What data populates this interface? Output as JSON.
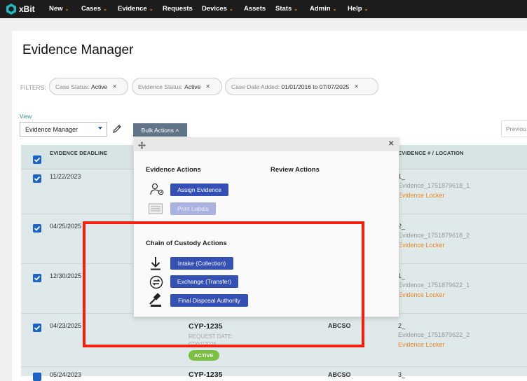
{
  "nav": {
    "brand": "xBit",
    "items": [
      {
        "label": "New",
        "caret": true
      },
      {
        "label": "Cases",
        "caret": true
      },
      {
        "label": "Evidence",
        "caret": true
      },
      {
        "label": "Requests",
        "caret": false
      },
      {
        "label": "Devices",
        "caret": true
      },
      {
        "label": "Assets",
        "caret": false
      },
      {
        "label": "Stats",
        "caret": true
      },
      {
        "label": "Admin",
        "caret": true
      },
      {
        "label": "Help",
        "caret": true
      }
    ]
  },
  "page": {
    "title": "Evidence Manager"
  },
  "filters": {
    "label": "FILTERS:",
    "chips": [
      {
        "name": "Case Status:",
        "value": "Active"
      },
      {
        "name": "Evidence Status:",
        "value": "Active"
      },
      {
        "name": "Case Date Added:",
        "value": "01/01/2016 to 07/07/2025"
      }
    ]
  },
  "view": {
    "label": "View",
    "selected": "Evidence Manager"
  },
  "toolbar": {
    "bulk_actions": "Bulk Actions ˄",
    "previous": "Previou"
  },
  "table": {
    "headers": {
      "deadline": "EVIDENCE DEADLINE",
      "evidence": "EVIDENCE # / LOCATION"
    },
    "rows": [
      {
        "deadline": "11/22/2023",
        "num": "1_",
        "name": "Evidence_1751879618_1",
        "location": "Evidence Locker"
      },
      {
        "deadline": "04/25/2025",
        "num": "2_",
        "name": "Evidence_1751879618_2",
        "location": "Evidence Locker"
      },
      {
        "deadline": "12/30/2025",
        "num": "1_",
        "name": "Evidence_1751879622_1",
        "location": "Evidence Locker"
      },
      {
        "deadline": "04/23/2025",
        "case": "CYP-1235",
        "req_label": "REQUEST DATE:",
        "req_date": "07/07/2025",
        "status": "ACTIVE",
        "agency": "ABCSO",
        "num": "2_",
        "name": "Evidence_1751879622_2",
        "location": "Evidence Locker"
      },
      {
        "deadline": "05/24/2023",
        "case": "CYP-1235",
        "agency": "ABCSO",
        "num": "3_"
      }
    ]
  },
  "popup": {
    "evidence_actions_title": "Evidence Actions",
    "review_actions_title": "Review Actions",
    "assign_evidence": "Assign Evidence",
    "print_labels": "Print Labels",
    "chain_title": "Chain of Custody Actions",
    "intake": "Intake (Collection)",
    "exchange": "Exchange (Transfer)",
    "final_disposal": "Final Disposal Authority"
  },
  "colors": {
    "nav_bg": "#1c1c1c",
    "accent_caret": "#e8a020",
    "action_button": "#3450b4",
    "location_text": "#e8871e",
    "status_active": "#7ac142",
    "highlight_box": "#f2200c"
  }
}
